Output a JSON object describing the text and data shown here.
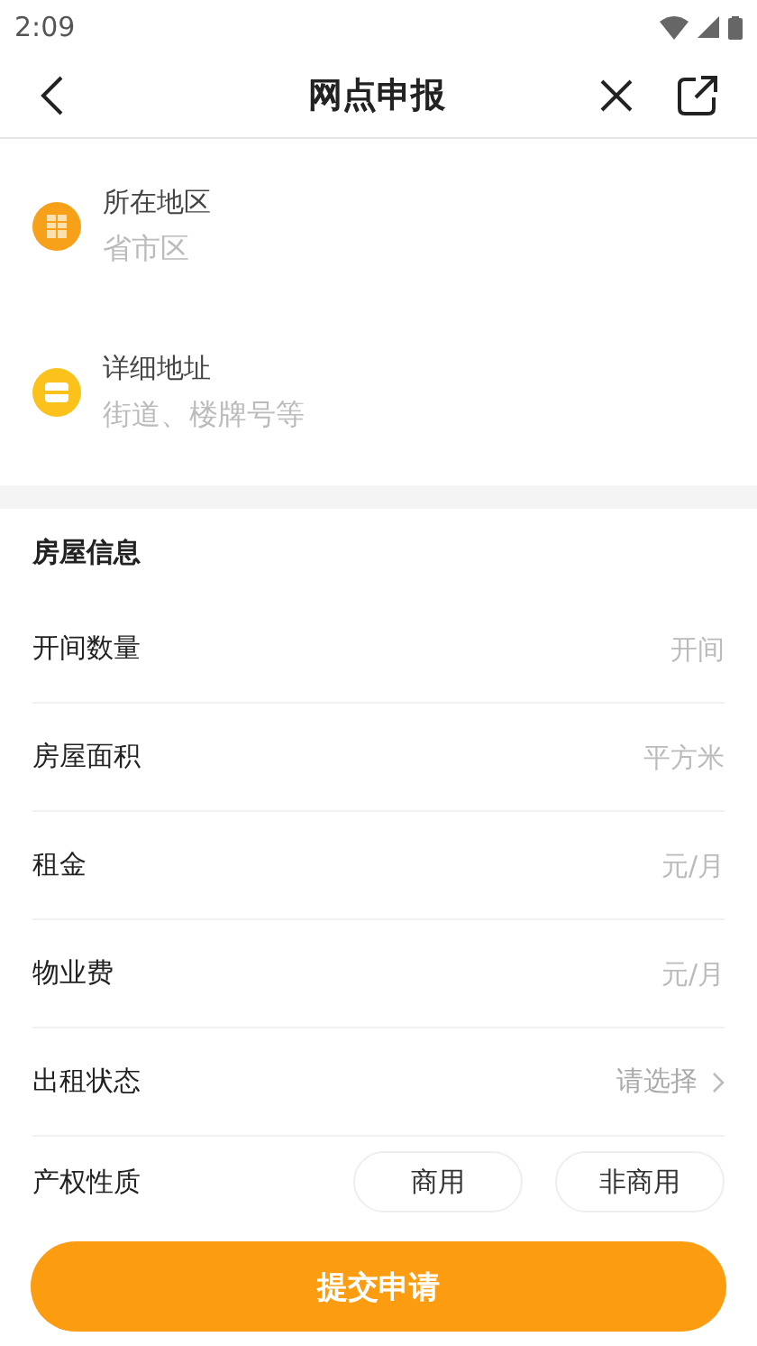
{
  "status_bar": {
    "time": "2:09"
  },
  "header": {
    "title": "网点申报"
  },
  "address": [
    {
      "kind": "region",
      "label": "所在地区",
      "placeholder": "省市区"
    },
    {
      "kind": "detail",
      "label": "详细地址",
      "placeholder": "街道、楼牌号等"
    }
  ],
  "house_info": {
    "title": "房屋信息",
    "rows": [
      {
        "kind": "input",
        "label": "开间数量",
        "placeholder": "开间"
      },
      {
        "kind": "input",
        "label": "房屋面积",
        "placeholder": "平方米"
      },
      {
        "kind": "input",
        "label": "租金",
        "placeholder": "元/月"
      },
      {
        "kind": "input",
        "label": "物业费",
        "placeholder": "元/月"
      },
      {
        "kind": "select",
        "label": "出租状态",
        "placeholder": "请选择"
      },
      {
        "kind": "options",
        "label": "产权性质",
        "options": [
          {
            "label": "商用",
            "selected": false
          },
          {
            "label": "非商用",
            "selected": false
          }
        ]
      }
    ]
  },
  "submit": {
    "label": "提交申请"
  }
}
